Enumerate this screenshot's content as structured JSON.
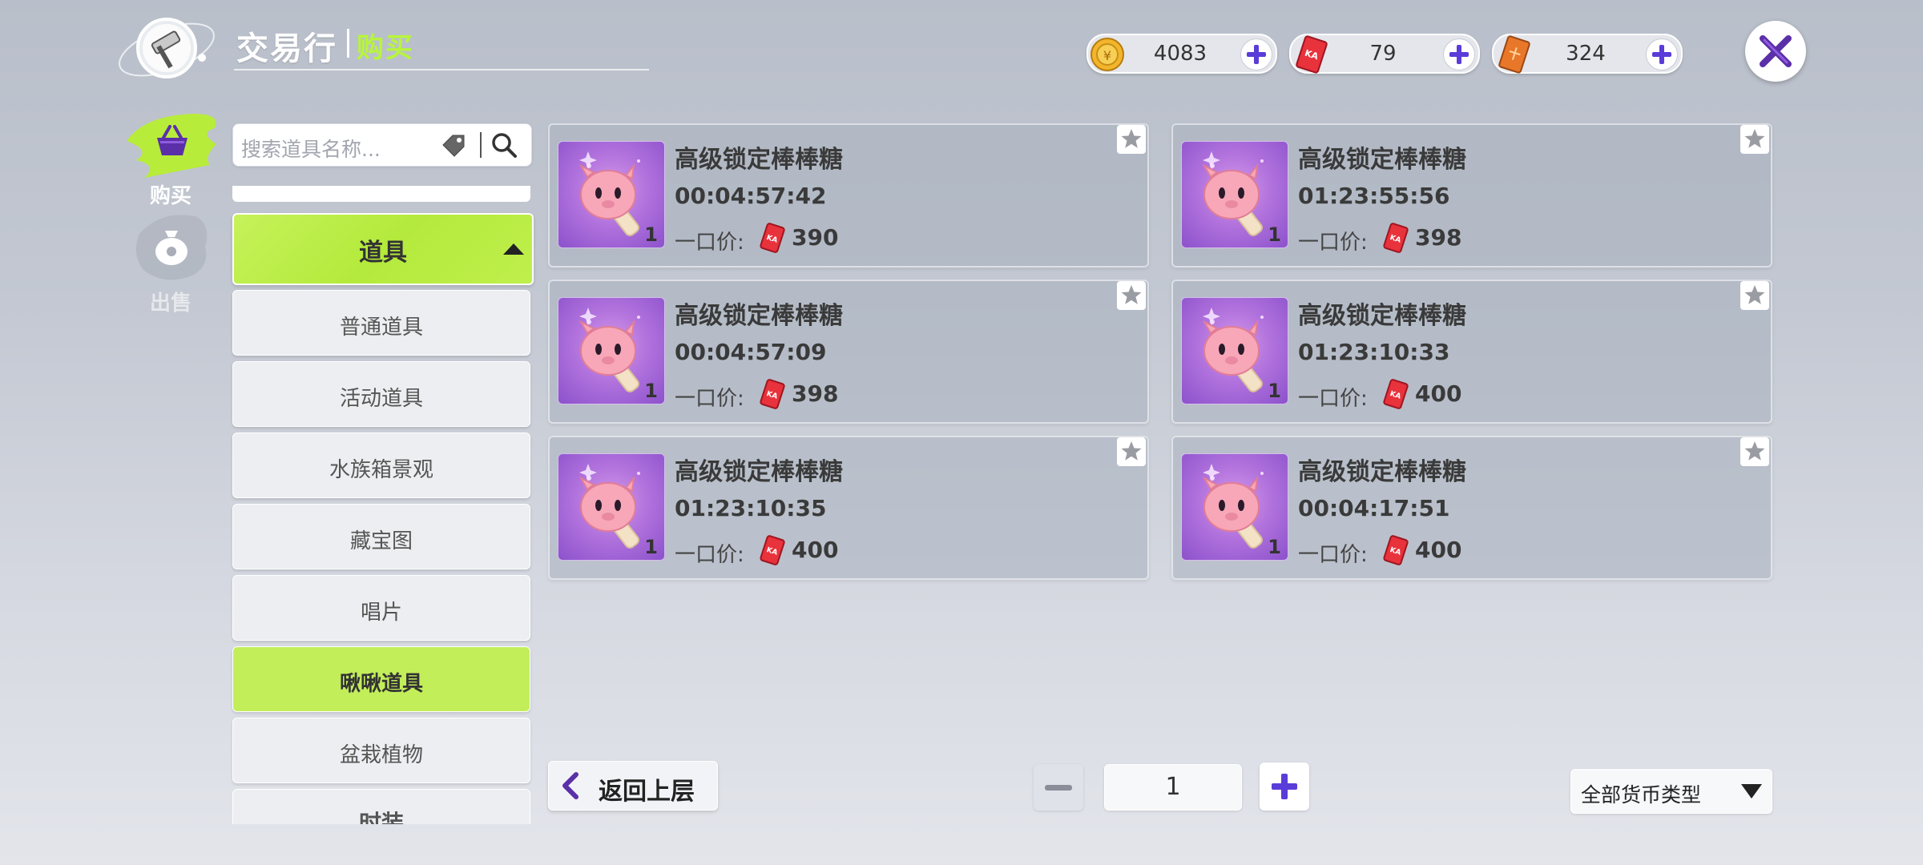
{
  "header": {
    "title": "交易行",
    "subtitle": "购买"
  },
  "currencies": [
    {
      "icon": "gold-coin-icon",
      "value": "4083"
    },
    {
      "icon": "red-ticket-icon",
      "value": "79"
    },
    {
      "icon": "orange-ticket-icon",
      "value": "324"
    }
  ],
  "tabs": {
    "buy": "购买",
    "sell": "出售"
  },
  "search": {
    "placeholder": "搜索道具名称..."
  },
  "categories": {
    "main": "道具",
    "items": [
      "普通道具",
      "活动道具",
      "水族箱景观",
      "藏宝图",
      "唱片",
      "啾啾道具",
      "盆栽植物",
      "时装"
    ],
    "active_index": 5
  },
  "products": [
    {
      "name": "高级锁定棒棒糖",
      "time": "00:04:57:42",
      "price_label": "一口价:",
      "price": "390",
      "qty": "1"
    },
    {
      "name": "高级锁定棒棒糖",
      "time": "01:23:55:56",
      "price_label": "一口价:",
      "price": "398",
      "qty": "1"
    },
    {
      "name": "高级锁定棒棒糖",
      "time": "00:04:57:09",
      "price_label": "一口价:",
      "price": "398",
      "qty": "1"
    },
    {
      "name": "高级锁定棒棒糖",
      "time": "01:23:10:33",
      "price_label": "一口价:",
      "price": "400",
      "qty": "1"
    },
    {
      "name": "高级锁定棒棒糖",
      "time": "01:23:10:35",
      "price_label": "一口价:",
      "price": "400",
      "qty": "1"
    },
    {
      "name": "高级锁定棒棒糖",
      "time": "00:04:17:51",
      "price_label": "一口价:",
      "price": "400",
      "qty": "1"
    }
  ],
  "footer": {
    "back_label": "返回上层",
    "page": "1",
    "currency_filter": "全部货币类型"
  },
  "colors": {
    "accent_green": "#b7f53b",
    "close_purple": "#5b2fa8",
    "ticket_red": "#e8323c"
  }
}
